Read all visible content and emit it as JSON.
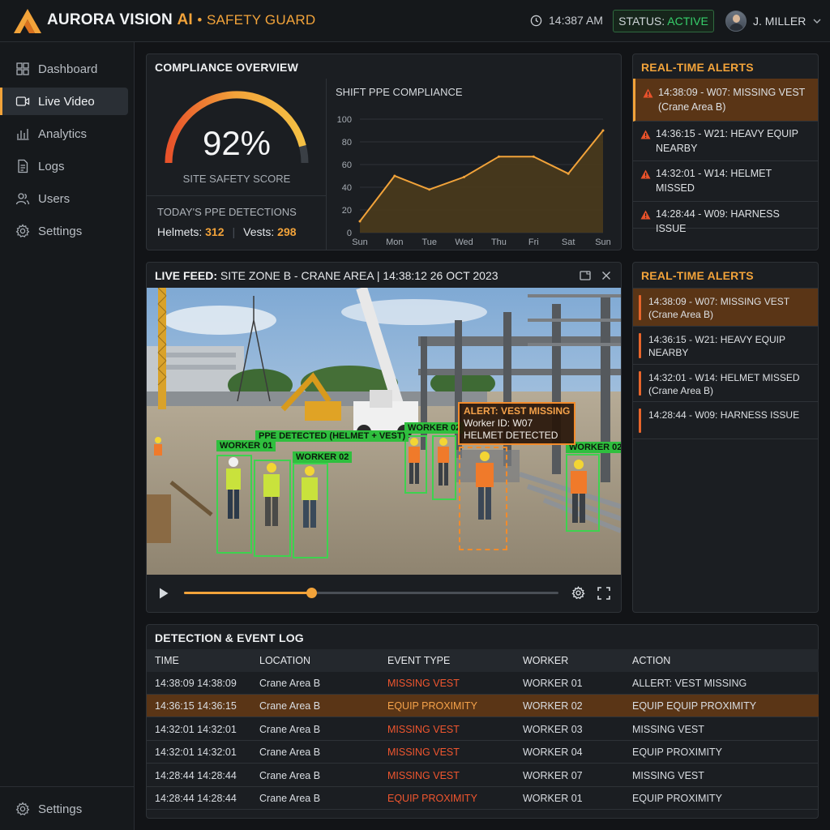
{
  "header": {
    "brand_name": "AURORA VISION",
    "brand_ai": "AI",
    "brand_sep": "•",
    "brand_product": "SAFETY GUARD",
    "time": "14:387 AM",
    "status_label": "STATUS:",
    "status_value": "ACTIVE",
    "user_name": "J. MILLER"
  },
  "sidebar": {
    "items": [
      {
        "label": "Dashboard",
        "icon": "dashboard-icon"
      },
      {
        "label": "Live Video",
        "icon": "video-icon"
      },
      {
        "label": "Analytics",
        "icon": "analytics-icon"
      },
      {
        "label": "Logs",
        "icon": "logs-icon"
      },
      {
        "label": "Users",
        "icon": "users-icon"
      },
      {
        "label": "Settings",
        "icon": "gear-icon"
      }
    ],
    "bottom_label": "Settings"
  },
  "compliance": {
    "title": "COMPLIANCE OVERVIEW",
    "score": "92%",
    "score_fraction": 0.92,
    "score_label": "SITE SAFETY SCORE",
    "detections_label": "TODAY'S PPE DETECTIONS",
    "helmets_label": "Helmets:",
    "helmets_value": "312",
    "vests_label": "Vests:",
    "vests_value": "298"
  },
  "chart_data": {
    "type": "area",
    "title": "SHIFT PPE COMPLIANCE",
    "categories": [
      "Sun",
      "Mon",
      "Tue",
      "Wed",
      "Thu",
      "Fri",
      "Sat",
      "Sun"
    ],
    "values": [
      10,
      50,
      38,
      49,
      67,
      67,
      52,
      90
    ],
    "yticks": [
      0,
      20,
      40,
      60,
      80,
      100
    ],
    "ylim": [
      0,
      100
    ],
    "grid": true,
    "colors": {
      "line": "#f2a33a",
      "fill": "#4a3a1c"
    }
  },
  "alerts_top": {
    "title": "REAL-TIME ALERTS",
    "items": [
      {
        "text": "14:38:09 - W07: MISSING VEST (Crane Area B)",
        "highlight": true
      },
      {
        "text": "14:36:15 - W21: HEAVY EQUIP NEARBY",
        "highlight": false
      },
      {
        "text": "14:32:01 - W14: HELMET MISSED",
        "highlight": false
      },
      {
        "text": "14:28:44 - W09: HARNESS ISSUE",
        "highlight": false
      }
    ]
  },
  "alerts_side": {
    "title": "REAL-TIME ALERTS",
    "items": [
      {
        "text": "14:38:09 - W07: MISSING VEST (Crane Area B)",
        "highlight": true
      },
      {
        "text": "14:36:15 - W21: HEAVY EQUIP NEARBY",
        "highlight": false
      },
      {
        "text": "14:32:01 - W14: HELMET MISSED (Crane Area B)",
        "highlight": false
      },
      {
        "text": "14:28:44 - W09: HARNESS ISSUE",
        "highlight": false
      }
    ]
  },
  "feed": {
    "title_bold": "LIVE FEED:",
    "title_rest": "SITE ZONE B - CRANE AREA | 14:38:12 26 OCT 2023",
    "labels": {
      "ppe": "PPE DETECTED (HELMET + VEST)",
      "w01": "WORKER 01",
      "w02a": "WORKER 02",
      "w02b": "WORKER 02",
      "w02c": "WORKER 02",
      "alert_title": "ALERT: VEST MISSING",
      "alert_worker": "Worker ID: W07",
      "alert_helmet": "HELMET DETECTED"
    },
    "progress": 0.34
  },
  "log": {
    "title": "DETECTION & EVENT LOG",
    "columns": [
      "TIME",
      "LOCATION",
      "EVENT TYPE",
      "WORKER",
      "ACTION"
    ],
    "rows": [
      {
        "time": "14:38:09 14:38:09",
        "location": "Crane Area B",
        "event": "MISSING VEST",
        "worker": "WORKER 01",
        "action": "ALLERT: VEST MISSING",
        "highlight": false
      },
      {
        "time": "14:36:15 14:36:15",
        "location": "Crane Area B",
        "event": "EQUIP PROXIMITY",
        "worker": "WORKER 02",
        "action": "EQUIP EQUIP PROXIMITY",
        "highlight": true
      },
      {
        "time": "14:32:01 14:32:01",
        "location": "Crane Area B",
        "event": "MISSING VEST",
        "worker": "WORKER 03",
        "action": "MISSING VEST",
        "highlight": false
      },
      {
        "time": "14:32:01 14:32:01",
        "location": "Crane Area B",
        "event": "MISSING VEST",
        "worker": "WORKER 04",
        "action": "EQUIP PROXIMITY",
        "highlight": false
      },
      {
        "time": "14:28:44 14:28:44",
        "location": "Crane Area B",
        "event": "MISSING VEST",
        "worker": "WORKER 07",
        "action": "MISSING VEST",
        "highlight": false
      },
      {
        "time": "14:28:44 14:28:44",
        "location": "Crane Area B",
        "event": "EQUIP PROXIMITY",
        "worker": "WORKER 01",
        "action": "EQUIP PROXIMITY",
        "highlight": false
      }
    ]
  }
}
